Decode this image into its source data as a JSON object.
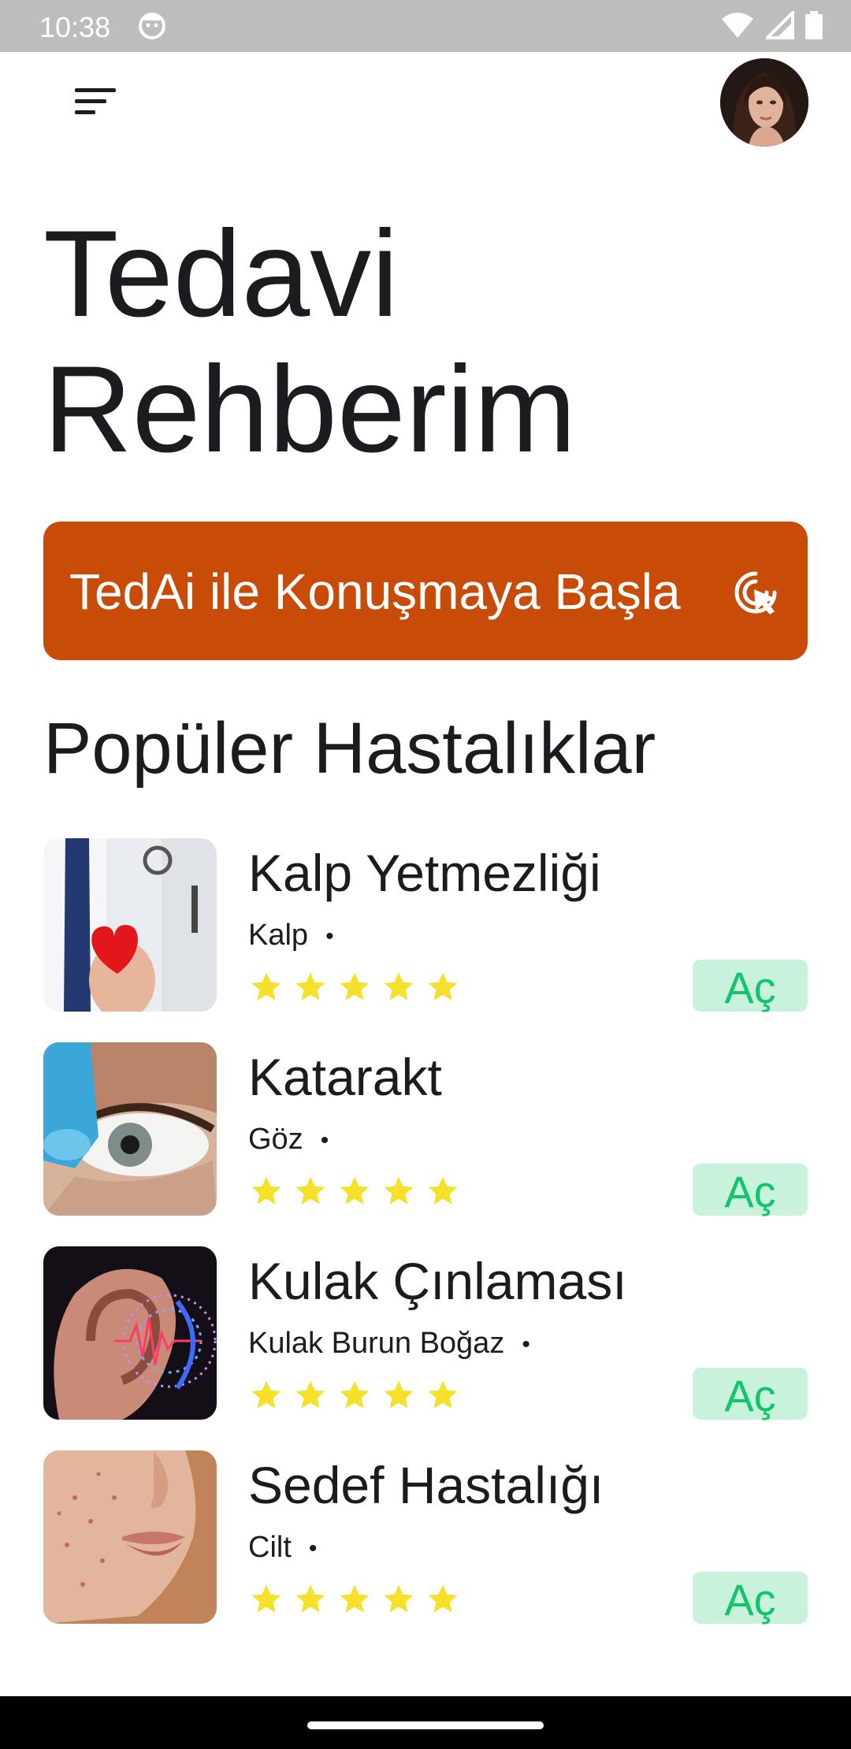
{
  "status_bar": {
    "time": "10:38",
    "icons": [
      "wifi-icon",
      "signal-icon",
      "battery-icon"
    ],
    "app_icon": "face-icon"
  },
  "app_bar": {
    "menu_icon": "sort-menu-icon",
    "avatar": "user-avatar"
  },
  "header": {
    "title_line1": "Tedavi",
    "title_line2": "Rehberim"
  },
  "chat_button": {
    "label": "TedAi ile Konuşmaya Başla",
    "icon": "touch-click-icon",
    "color": "#c84b07"
  },
  "popular": {
    "title": "Popüler Hastalıklar",
    "items": [
      {
        "title": "Kalp Yetmezliği",
        "category": "Kalp",
        "rating": 5,
        "open_label": "Aç",
        "image": "doctor-heart-photo"
      },
      {
        "title": "Katarakt",
        "category": "Göz",
        "rating": 5,
        "open_label": "Aç",
        "image": "eye-drop-photo"
      },
      {
        "title": "Kulak Çınlaması",
        "category": "Kulak Burun Boğaz",
        "rating": 5,
        "open_label": "Aç",
        "image": "ear-sound-photo"
      },
      {
        "title": "Sedef Hastalığı",
        "category": "Cilt",
        "rating": 5,
        "open_label": "Aç",
        "image": "skin-face-photo"
      }
    ]
  },
  "colors": {
    "star": "#f7e02a",
    "open_bg": "#c9f2dd",
    "open_text": "#12c46b"
  }
}
